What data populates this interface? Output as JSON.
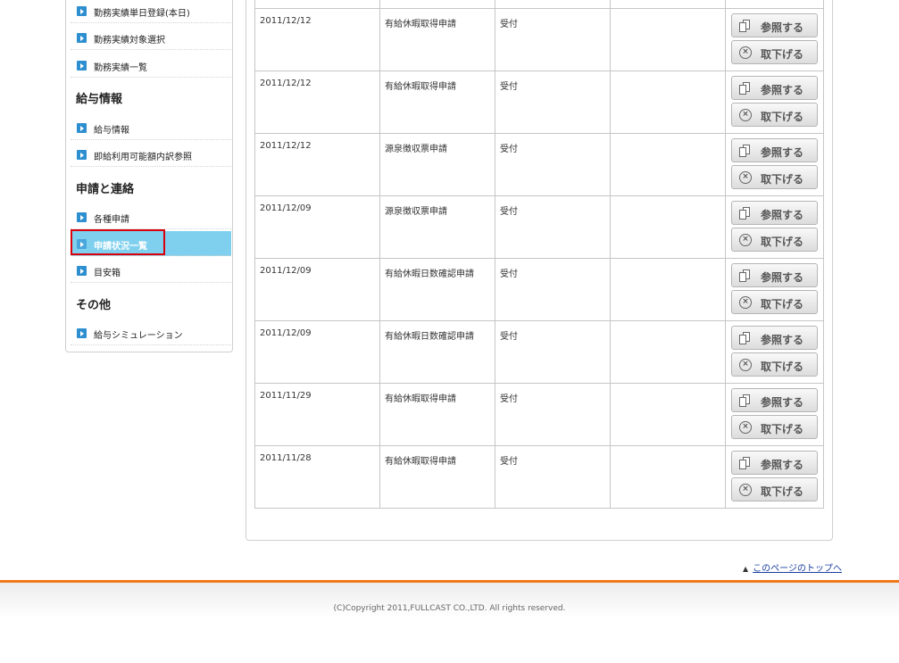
{
  "sidebar": {
    "group1_items": [
      {
        "label": "勤務実績単日登録(本日)"
      },
      {
        "label": "勤務実績対象選択"
      },
      {
        "label": "勤務実績一覧"
      }
    ],
    "group2_heading": "給与情報",
    "group2_items": [
      {
        "label": "給与情報"
      },
      {
        "label": "即給利用可能額内訳参照"
      }
    ],
    "group3_heading": "申請と連絡",
    "group3_items": [
      {
        "label": "各種申請"
      },
      {
        "label": "申請状況一覧"
      },
      {
        "label": "目安箱"
      }
    ],
    "group4_heading": "その他",
    "group4_items": [
      {
        "label": "給与シミュレーション"
      }
    ]
  },
  "table": {
    "rows": [
      {
        "date": "2011/12/12",
        "type": "有給休暇取得申請",
        "status": "受付",
        "note": ""
      },
      {
        "date": "2011/12/12",
        "type": "有給休暇取得申請",
        "status": "受付",
        "note": ""
      },
      {
        "date": "2011/12/12",
        "type": "源泉徴収票申請",
        "status": "受付",
        "note": ""
      },
      {
        "date": "2011/12/09",
        "type": "源泉徴収票申請",
        "status": "受付",
        "note": ""
      },
      {
        "date": "2011/12/09",
        "type": "有給休暇日数確認申請",
        "status": "受付",
        "note": ""
      },
      {
        "date": "2011/12/09",
        "type": "有給休暇日数確認申請",
        "status": "受付",
        "note": ""
      },
      {
        "date": "2011/11/29",
        "type": "有給休暇取得申請",
        "status": "受付",
        "note": ""
      },
      {
        "date": "2011/11/28",
        "type": "有給休暇取得申請",
        "status": "受付",
        "note": ""
      }
    ],
    "view_label": "参照する",
    "withdraw_label": "取下げる"
  },
  "pagetop": {
    "arrow": "▲",
    "link_label": "このページのトップへ"
  },
  "footer": {
    "copyright": "(C)Copyright 2011,FULLCAST CO.,LTD. All rights reserved."
  },
  "colors": {
    "accent_orange": "#f07a1a",
    "active_nav": "#7fd0ee",
    "highlight_red": "#d8000c",
    "nav_arrow": "#2d8fd0"
  }
}
